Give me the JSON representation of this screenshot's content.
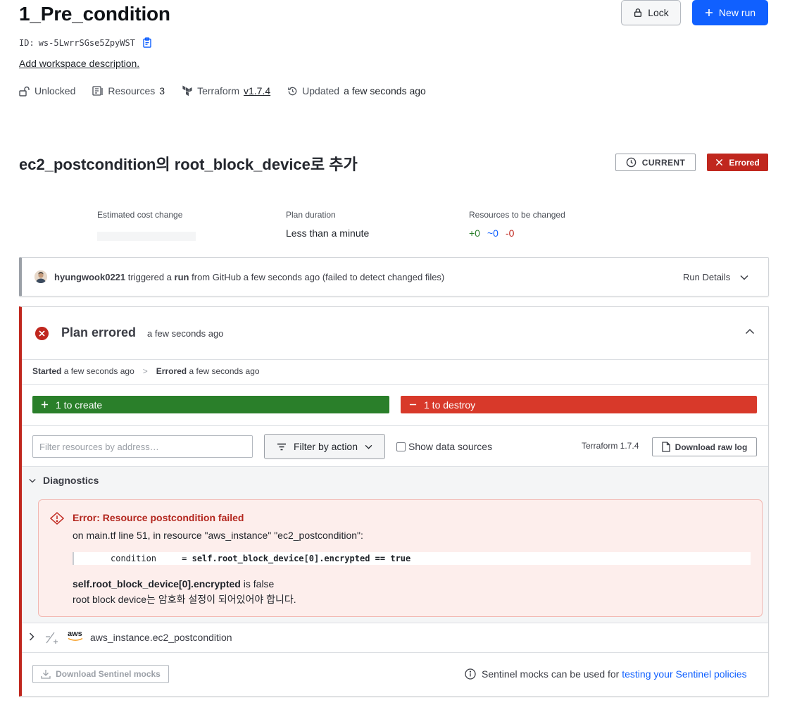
{
  "workspace": {
    "title": "1_Pre_condition",
    "id_label": "ID:",
    "id_value": "ws-5LwrrSGse5ZpyWST",
    "description_link": "Add workspace description.",
    "lock_label": "Lock",
    "new_run_label": "New run",
    "meta": {
      "lock_status": "Unlocked",
      "resources_label": "Resources",
      "resources_count": "3",
      "terraform_label": "Terraform",
      "terraform_version": "v1.7.4",
      "updated_label": "Updated",
      "updated_value": "a few seconds ago"
    }
  },
  "run": {
    "title": "ec2_postcondition의 root_block_device로 추가",
    "current_badge": "CURRENT",
    "status_badge": "Errored",
    "stats": {
      "cost_label": "Estimated cost change",
      "duration_label": "Plan duration",
      "duration_value": "Less than a minute",
      "changes_label": "Resources to be changed",
      "add": "+0",
      "change": "~0",
      "destroy": "-0"
    },
    "trigger": {
      "user": "hyungwook0221",
      "text_a": "triggered a",
      "run_word": "run",
      "text_b": "from GitHub a few seconds ago (failed to detect changed files)",
      "details_label": "Run Details"
    }
  },
  "plan": {
    "title": "Plan errored",
    "time": "a few seconds ago",
    "started_label": "Started",
    "started_value": "a few seconds ago",
    "errored_label": "Errored",
    "errored_value": "a few seconds ago",
    "create_label": "1 to create",
    "destroy_label": "1 to destroy",
    "filter_placeholder": "Filter resources by address…",
    "filter_action_label": "Filter by action",
    "show_data_sources_label": "Show data sources",
    "terraform_version": "Terraform 1.7.4",
    "download_raw_log": "Download raw log",
    "diagnostics_label": "Diagnostics",
    "error": {
      "title": "Error: Resource postcondition failed",
      "location": "on main.tf line 51, in resource \"aws_instance\" \"ec2_postcondition\":",
      "code_key": "condition     = ",
      "code_expr": "self.root_block_device[0].encrypted == true",
      "expr": "self.root_block_device[0].encrypted",
      "expr_suffix": " is false",
      "message": "root block device는 암호화 설정이 되어있어야 합니다."
    },
    "resource": {
      "provider": "aws",
      "name": "aws_instance.ec2_postcondition"
    },
    "download_sentinel": "Download Sentinel mocks",
    "sentinel_note": "Sentinel mocks can be used for",
    "sentinel_link": "testing your Sentinel policies"
  },
  "colors": {
    "primary": "#1060ff",
    "error": "#c0271e",
    "create": "#2a7f2a",
    "destroy": "#d8392a",
    "add_count": "#2a7f2a",
    "change_count": "#1060ff",
    "destroy_count": "#c0271e"
  },
  "icons": [
    "lock-icon",
    "plus-icon",
    "clipboard-icon",
    "unlock-icon",
    "resources-icon",
    "terraform-icon",
    "history-icon",
    "clock-icon",
    "x-icon",
    "chevron-down-icon",
    "chevron-up-icon",
    "error-circle-icon",
    "minus-icon",
    "filter-icon",
    "file-icon",
    "warning-diamond-icon",
    "chevron-right-icon",
    "resource-replace-icon",
    "download-icon",
    "info-icon"
  ]
}
